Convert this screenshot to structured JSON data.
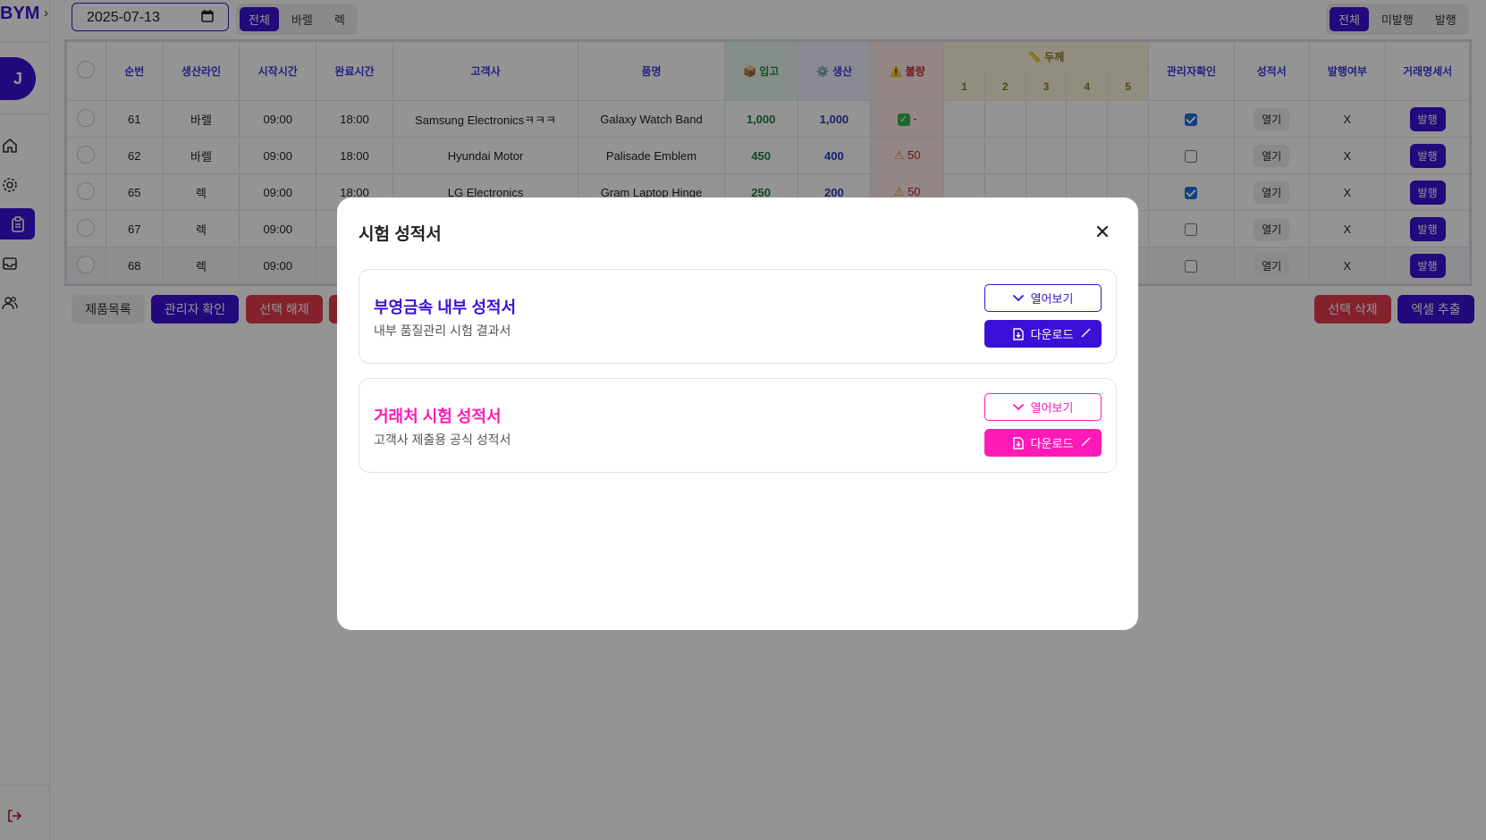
{
  "brand": "BYM",
  "avatar": "J",
  "topbar": {
    "date_value": "2025-07-13",
    "line_filter": [
      "전체",
      "바렐",
      "렉"
    ],
    "issue_filter": [
      "전체",
      "미발행",
      "발행"
    ]
  },
  "table": {
    "headers": {
      "seq": "순번",
      "line": "생산라인",
      "start": "시작시간",
      "end": "완료시간",
      "customer": "고객사",
      "product": "품명",
      "in": "📦 입고",
      "produced": "⚙️ 생산",
      "defect": "⚠️ 불량",
      "thickness": "📏 두께",
      "thickness_cols": [
        "1",
        "2",
        "3",
        "4",
        "5"
      ],
      "admin": "관리자확인",
      "report": "성적서",
      "issued": "발행여부",
      "invoice": "거래명세서"
    },
    "rows": [
      {
        "seq": "61",
        "line": "바렐",
        "start": "09:00",
        "end": "18:00",
        "customer": "Samsung Electronicsㅋㅋㅋ",
        "product": "Galaxy Watch Band",
        "in": "1,000",
        "produced": "1,000",
        "defect": "-",
        "defect_ok": true,
        "admin": true,
        "report": "열기",
        "issued": "X",
        "invoice": "발행"
      },
      {
        "seq": "62",
        "line": "바렐",
        "start": "09:00",
        "end": "18:00",
        "customer": "Hyundai Motor",
        "product": "Palisade Emblem",
        "in": "450",
        "produced": "400",
        "defect": "50",
        "defect_ok": false,
        "admin": false,
        "report": "열기",
        "issued": "X",
        "invoice": "발행"
      },
      {
        "seq": "65",
        "line": "렉",
        "start": "09:00",
        "end": "18:00",
        "customer": "LG Electronics",
        "product": "Gram Laptop Hinge",
        "in": "250",
        "produced": "200",
        "defect": "50",
        "defect_ok": false,
        "admin": true,
        "report": "열기",
        "issued": "X",
        "invoice": "발행"
      },
      {
        "seq": "67",
        "line": "렉",
        "start": "09:00",
        "end": "",
        "customer": "",
        "product": "",
        "in": "",
        "produced": "",
        "defect": "",
        "defect_ok": false,
        "admin": false,
        "report": "열기",
        "issued": "X",
        "invoice": "발행"
      },
      {
        "seq": "68",
        "line": "렉",
        "start": "09:00",
        "end": "",
        "customer": "",
        "product": "",
        "in": "",
        "produced": "",
        "defect": "",
        "defect_ok": false,
        "admin": false,
        "report": "열기",
        "issued": "X",
        "invoice": "발행"
      }
    ]
  },
  "actions": {
    "product_list": "제품목록",
    "admin_confirm": "관리자 확인",
    "deselect": "선택 해제",
    "delete_selected": "선택 삭제",
    "excel_export": "엑셀 추출"
  },
  "modal": {
    "title": "시험 성적서",
    "cards": [
      {
        "title": "부영금속 내부 성적서",
        "subtitle": "내부 품질관리 시험 결과서",
        "view_label": "열어보기",
        "download_label": "다운로드",
        "color": "#3b10d6"
      },
      {
        "title": "거래처 시험 성적서",
        "subtitle": "고객사 제출용 공식 성적서",
        "view_label": "열어보기",
        "download_label": "다운로드",
        "color": "#ff1ab8"
      }
    ]
  }
}
